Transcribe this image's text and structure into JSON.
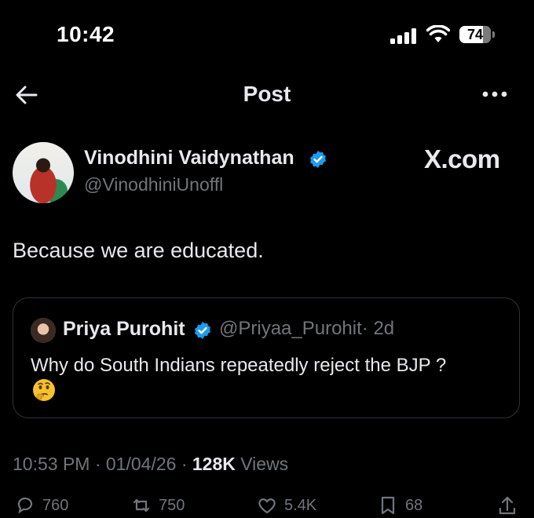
{
  "status_bar": {
    "time": "10:42",
    "battery": "74",
    "battery_level": 0.74
  },
  "header": {
    "title": "Post"
  },
  "author": {
    "name": "Vinodhini Vaidynathan",
    "handle": "@VinodhiniUnoffl"
  },
  "watermark": "X.com",
  "post": {
    "text": "Because we are educated."
  },
  "quote": {
    "name": "Priya Purohit",
    "handle": "@Priyaa_Purohit",
    "time": "· 2d",
    "text": "Why do South Indians repeatedly reject the BJP ?"
  },
  "meta": {
    "time": "10:53 PM",
    "date": "· 01/04/26 ·",
    "views_count": "128K",
    "views_label": "Views"
  },
  "actions": {
    "replies": "760",
    "reposts": "750",
    "likes": "5.4K",
    "bookmarks": "68"
  },
  "colors": {
    "background": "#000000",
    "text": "#e7e9ea",
    "muted": "#71767b",
    "verified": "#1d9bf0",
    "border": "#2f3336"
  }
}
